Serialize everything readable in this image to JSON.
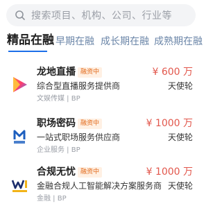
{
  "search": {
    "placeholder": "搜索项目、机构、公司、行业等"
  },
  "tabs": [
    {
      "label": "精品在融"
    },
    {
      "label": "早期在融"
    },
    {
      "label": "成长期在融"
    },
    {
      "label": "成熟期在融"
    }
  ],
  "projects": [
    {
      "name": "龙地直播",
      "badge": "融资中",
      "amount": "¥ 600 万",
      "round": "天使轮",
      "desc": "综合型直播服务提供商",
      "meta": "文娱传媒 | BP"
    },
    {
      "name": "职场密码",
      "badge": "融资中",
      "amount": "¥ 1000 万",
      "round": "天使轮",
      "desc": "一站式职场服务供应商",
      "meta": "企业服务 | BP"
    },
    {
      "name": "合规无忧",
      "badge": "融资中",
      "amount": "¥ 1000 万",
      "round": "天使轮",
      "desc": "金融合规人工智能解决方案服务商",
      "meta": "金融 | BP"
    }
  ],
  "colors": {
    "accent": "#1c6fe8",
    "amount": "#e2574c",
    "badge_text": "#e26a1b",
    "badge_bg": "#fff0e3"
  },
  "icons": [
    "search-icon",
    "play-logo",
    "career-code-logo",
    "compliance-logo"
  ]
}
